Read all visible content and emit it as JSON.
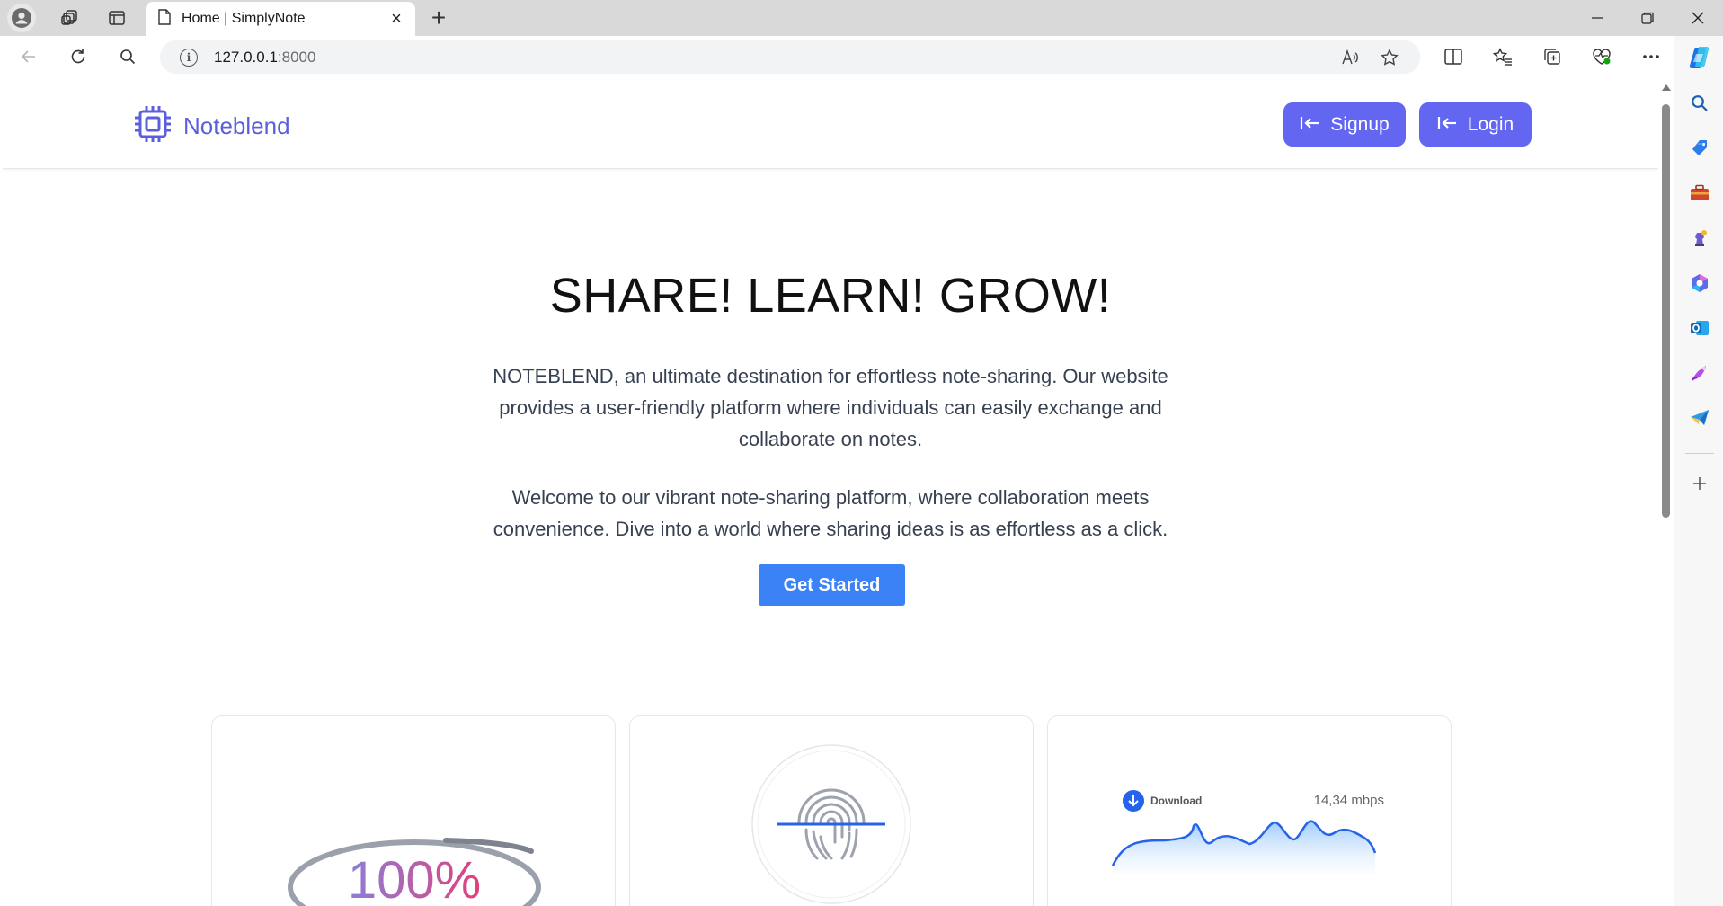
{
  "browser": {
    "tab_title": "Home | SimplyNote",
    "url_host": "127.0.0.1",
    "url_port": ":8000"
  },
  "site": {
    "brand_name": "Noteblend",
    "signup_label": "Signup",
    "login_label": "Login",
    "hero_title": "SHARE! LEARN! GROW!",
    "hero_paragraph_1": "NOTEBLEND, an ultimate destination for effortless note-sharing. Our website provides a user-friendly platform where individuals can easily exchange and collaborate on notes.",
    "hero_paragraph_2": "Welcome to our vibrant note-sharing platform, where collaboration meets convenience. Dive into a world where sharing ideas is as effortless as a click.",
    "cta_label": "Get Started",
    "accent_color": "#6366f1",
    "cta_color": "#3b82f6"
  },
  "cards": {
    "card1_percent": "100%",
    "card3_download_label": "Download",
    "card3_speed": "14,34 mbps"
  }
}
